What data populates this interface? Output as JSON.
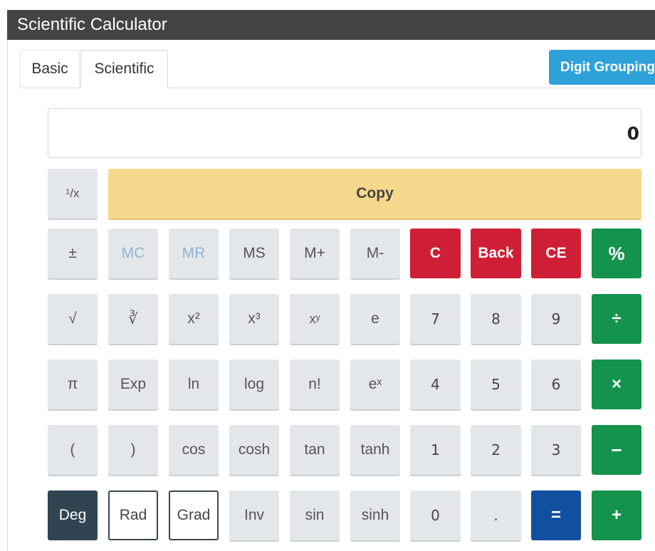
{
  "app": {
    "title": "Scientific Calculator"
  },
  "tabs": [
    {
      "label": "Basic",
      "active": false
    },
    {
      "label": "Scientific",
      "active": true
    }
  ],
  "digit_grouping": {
    "label": "Digit Grouping"
  },
  "display": {
    "value": "0"
  },
  "colors": {
    "title_bar": "#444444",
    "digit_grouping": "#2ea1d9",
    "copy": "#f6d88c",
    "clear": "#cf1f36",
    "operator": "#14934c",
    "equals": "#114fa0",
    "deg_active": "#314451",
    "key": "#e4e7ea",
    "memory_disabled_text": "#8fb3d1"
  },
  "buttons": {
    "reciprocal": "¹/x",
    "copy": "Copy",
    "plus_minus": "±",
    "mc": "MC",
    "mr": "MR",
    "ms": "MS",
    "m_plus": "M+",
    "m_minus": "M-",
    "clear": "C",
    "back": "Back",
    "ce": "CE",
    "percent": "%",
    "sqrt": "√",
    "yroot": "∛",
    "square": "x²",
    "cube": "x³",
    "power": "xʸ",
    "e": "e",
    "seven": "7",
    "eight": "8",
    "nine": "9",
    "divide": "÷",
    "pi": "π",
    "exp": "Exp",
    "ln": "ln",
    "log": "log",
    "factorial": "n!",
    "e_power": "eˣ",
    "four": "4",
    "five": "5",
    "six": "6",
    "multiply": "×",
    "open_paren": "(",
    "close_paren": ")",
    "cos": "cos",
    "cosh": "cosh",
    "tan": "tan",
    "tanh": "tanh",
    "one": "1",
    "two": "2",
    "three": "3",
    "minus": "−",
    "deg": "Deg",
    "rad": "Rad",
    "grad": "Grad",
    "inv": "Inv",
    "sin": "sin",
    "sinh": "sinh",
    "zero": "0",
    "decimal": ".",
    "equals": "=",
    "plus": "+"
  }
}
